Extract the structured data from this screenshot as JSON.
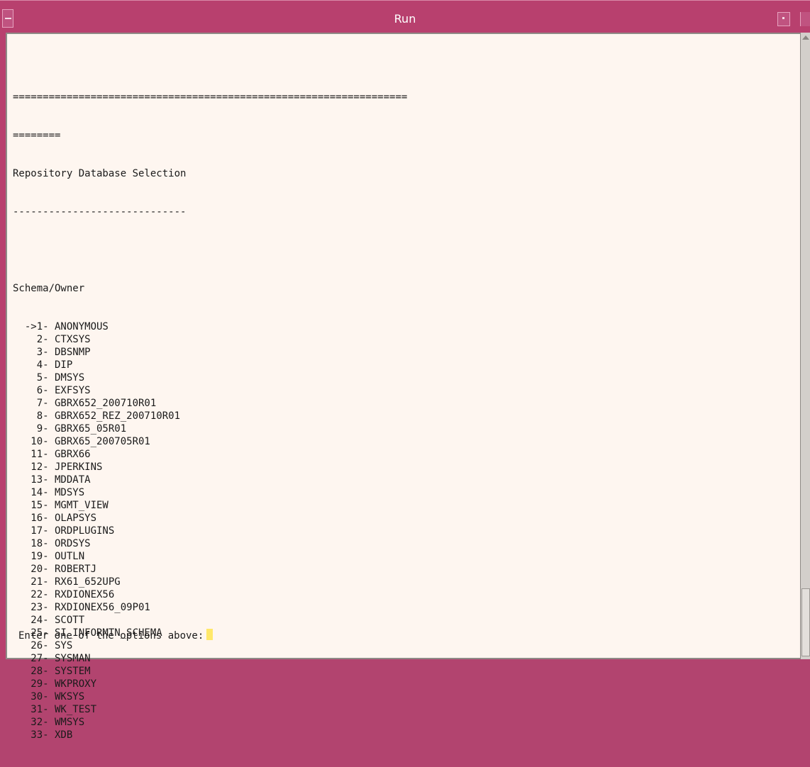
{
  "window": {
    "title": "Run"
  },
  "terminal": {
    "separator_long": "==================================================================",
    "separator_short": "========",
    "heading": "Repository Database Selection",
    "heading_underline": "-----------------------------",
    "blank": "",
    "list_header": "Schema/Owner",
    "items": [
      "  ->1- ANONYMOUS",
      "    2- CTXSYS",
      "    3- DBSNMP",
      "    4- DIP",
      "    5- DMSYS",
      "    6- EXFSYS",
      "    7- GBRX652_200710R01",
      "    8- GBRX652_REZ_200710R01",
      "    9- GBRX65_05R01",
      "   10- GBRX65_200705R01",
      "   11- GBRX66",
      "   12- JPERKINS",
      "   13- MDDATA",
      "   14- MDSYS",
      "   15- MGMT_VIEW",
      "   16- OLAPSYS",
      "   17- ORDPLUGINS",
      "   18- ORDSYS",
      "   19- OUTLN",
      "   20- ROBERTJ",
      "   21- RX61_652UPG",
      "   22- RXDIONEX56",
      "   23- RXDIONEX56_09P01",
      "   24- SCOTT",
      "   25- SI_INFORMTN_SCHEMA",
      "   26- SYS",
      "   27- SYSMAN",
      "   28- SYSTEM",
      "   29- WKPROXY",
      "   30- WKSYS",
      "   31- WK_TEST",
      "   32- WMSYS",
      "   33- XDB"
    ],
    "prompt": "Enter one of the options above:"
  },
  "icons": {
    "window_menu": "window-menu-icon",
    "minimize": "minimize-icon",
    "maximize": "maximize-icon",
    "scroll_up": "scroll-up-arrow-icon"
  },
  "colors": {
    "titlebar": "#b8406e",
    "terminal_bg": "#fef6f0",
    "cursor": "#ffe86a"
  }
}
